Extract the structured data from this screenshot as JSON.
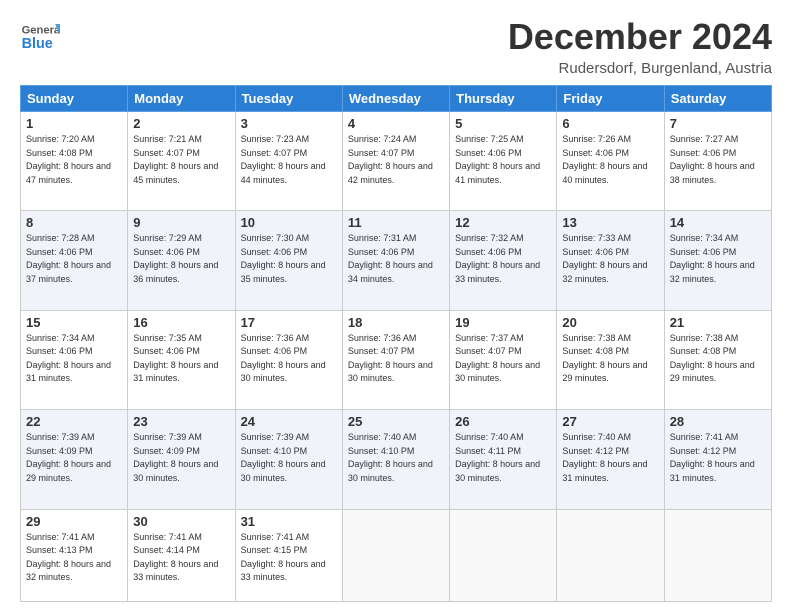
{
  "header": {
    "logo_general": "General",
    "logo_blue": "Blue",
    "month_title": "December 2024",
    "subtitle": "Rudersdorf, Burgenland, Austria"
  },
  "weekdays": [
    "Sunday",
    "Monday",
    "Tuesday",
    "Wednesday",
    "Thursday",
    "Friday",
    "Saturday"
  ],
  "weeks": [
    [
      {
        "day": "1",
        "sunrise": "Sunrise: 7:20 AM",
        "sunset": "Sunset: 4:08 PM",
        "daylight": "Daylight: 8 hours and 47 minutes."
      },
      {
        "day": "2",
        "sunrise": "Sunrise: 7:21 AM",
        "sunset": "Sunset: 4:07 PM",
        "daylight": "Daylight: 8 hours and 45 minutes."
      },
      {
        "day": "3",
        "sunrise": "Sunrise: 7:23 AM",
        "sunset": "Sunset: 4:07 PM",
        "daylight": "Daylight: 8 hours and 44 minutes."
      },
      {
        "day": "4",
        "sunrise": "Sunrise: 7:24 AM",
        "sunset": "Sunset: 4:07 PM",
        "daylight": "Daylight: 8 hours and 42 minutes."
      },
      {
        "day": "5",
        "sunrise": "Sunrise: 7:25 AM",
        "sunset": "Sunset: 4:06 PM",
        "daylight": "Daylight: 8 hours and 41 minutes."
      },
      {
        "day": "6",
        "sunrise": "Sunrise: 7:26 AM",
        "sunset": "Sunset: 4:06 PM",
        "daylight": "Daylight: 8 hours and 40 minutes."
      },
      {
        "day": "7",
        "sunrise": "Sunrise: 7:27 AM",
        "sunset": "Sunset: 4:06 PM",
        "daylight": "Daylight: 8 hours and 38 minutes."
      }
    ],
    [
      {
        "day": "8",
        "sunrise": "Sunrise: 7:28 AM",
        "sunset": "Sunset: 4:06 PM",
        "daylight": "Daylight: 8 hours and 37 minutes."
      },
      {
        "day": "9",
        "sunrise": "Sunrise: 7:29 AM",
        "sunset": "Sunset: 4:06 PM",
        "daylight": "Daylight: 8 hours and 36 minutes."
      },
      {
        "day": "10",
        "sunrise": "Sunrise: 7:30 AM",
        "sunset": "Sunset: 4:06 PM",
        "daylight": "Daylight: 8 hours and 35 minutes."
      },
      {
        "day": "11",
        "sunrise": "Sunrise: 7:31 AM",
        "sunset": "Sunset: 4:06 PM",
        "daylight": "Daylight: 8 hours and 34 minutes."
      },
      {
        "day": "12",
        "sunrise": "Sunrise: 7:32 AM",
        "sunset": "Sunset: 4:06 PM",
        "daylight": "Daylight: 8 hours and 33 minutes."
      },
      {
        "day": "13",
        "sunrise": "Sunrise: 7:33 AM",
        "sunset": "Sunset: 4:06 PM",
        "daylight": "Daylight: 8 hours and 32 minutes."
      },
      {
        "day": "14",
        "sunrise": "Sunrise: 7:34 AM",
        "sunset": "Sunset: 4:06 PM",
        "daylight": "Daylight: 8 hours and 32 minutes."
      }
    ],
    [
      {
        "day": "15",
        "sunrise": "Sunrise: 7:34 AM",
        "sunset": "Sunset: 4:06 PM",
        "daylight": "Daylight: 8 hours and 31 minutes."
      },
      {
        "day": "16",
        "sunrise": "Sunrise: 7:35 AM",
        "sunset": "Sunset: 4:06 PM",
        "daylight": "Daylight: 8 hours and 31 minutes."
      },
      {
        "day": "17",
        "sunrise": "Sunrise: 7:36 AM",
        "sunset": "Sunset: 4:06 PM",
        "daylight": "Daylight: 8 hours and 30 minutes."
      },
      {
        "day": "18",
        "sunrise": "Sunrise: 7:36 AM",
        "sunset": "Sunset: 4:07 PM",
        "daylight": "Daylight: 8 hours and 30 minutes."
      },
      {
        "day": "19",
        "sunrise": "Sunrise: 7:37 AM",
        "sunset": "Sunset: 4:07 PM",
        "daylight": "Daylight: 8 hours and 30 minutes."
      },
      {
        "day": "20",
        "sunrise": "Sunrise: 7:38 AM",
        "sunset": "Sunset: 4:08 PM",
        "daylight": "Daylight: 8 hours and 29 minutes."
      },
      {
        "day": "21",
        "sunrise": "Sunrise: 7:38 AM",
        "sunset": "Sunset: 4:08 PM",
        "daylight": "Daylight: 8 hours and 29 minutes."
      }
    ],
    [
      {
        "day": "22",
        "sunrise": "Sunrise: 7:39 AM",
        "sunset": "Sunset: 4:09 PM",
        "daylight": "Daylight: 8 hours and 29 minutes."
      },
      {
        "day": "23",
        "sunrise": "Sunrise: 7:39 AM",
        "sunset": "Sunset: 4:09 PM",
        "daylight": "Daylight: 8 hours and 30 minutes."
      },
      {
        "day": "24",
        "sunrise": "Sunrise: 7:39 AM",
        "sunset": "Sunset: 4:10 PM",
        "daylight": "Daylight: 8 hours and 30 minutes."
      },
      {
        "day": "25",
        "sunrise": "Sunrise: 7:40 AM",
        "sunset": "Sunset: 4:10 PM",
        "daylight": "Daylight: 8 hours and 30 minutes."
      },
      {
        "day": "26",
        "sunrise": "Sunrise: 7:40 AM",
        "sunset": "Sunset: 4:11 PM",
        "daylight": "Daylight: 8 hours and 30 minutes."
      },
      {
        "day": "27",
        "sunrise": "Sunrise: 7:40 AM",
        "sunset": "Sunset: 4:12 PM",
        "daylight": "Daylight: 8 hours and 31 minutes."
      },
      {
        "day": "28",
        "sunrise": "Sunrise: 7:41 AM",
        "sunset": "Sunset: 4:12 PM",
        "daylight": "Daylight: 8 hours and 31 minutes."
      }
    ],
    [
      {
        "day": "29",
        "sunrise": "Sunrise: 7:41 AM",
        "sunset": "Sunset: 4:13 PM",
        "daylight": "Daylight: 8 hours and 32 minutes."
      },
      {
        "day": "30",
        "sunrise": "Sunrise: 7:41 AM",
        "sunset": "Sunset: 4:14 PM",
        "daylight": "Daylight: 8 hours and 33 minutes."
      },
      {
        "day": "31",
        "sunrise": "Sunrise: 7:41 AM",
        "sunset": "Sunset: 4:15 PM",
        "daylight": "Daylight: 8 hours and 33 minutes."
      },
      null,
      null,
      null,
      null
    ]
  ]
}
